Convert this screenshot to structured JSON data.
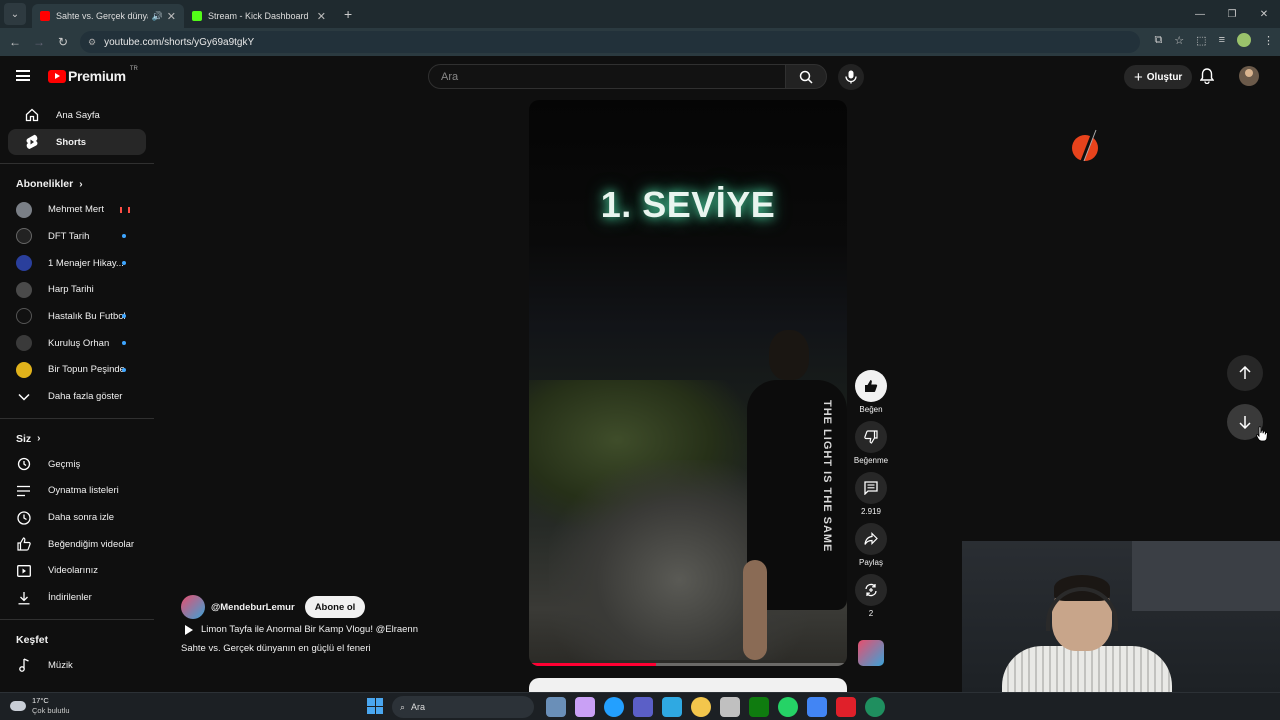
{
  "browser": {
    "tabs": [
      {
        "title": "Sahte vs. Gerçek dünyanın e",
        "active": true,
        "favicon_color": "#ff0000"
      },
      {
        "title": "Stream - Kick Dashboard",
        "active": false,
        "favicon_color": "#53fc18"
      }
    ],
    "url": "youtube.com/shorts/yGy69a9tgkY"
  },
  "header": {
    "logo_text": "Premium",
    "logo_region": "TR",
    "search_placeholder": "Ara",
    "create_label": "Oluştur"
  },
  "sidebar": {
    "main": [
      {
        "label": "Ana Sayfa",
        "icon": "home-icon"
      },
      {
        "label": "Shorts",
        "icon": "shorts-icon",
        "active": true
      }
    ],
    "subs_heading": "Abonelikler",
    "subs": [
      {
        "label": "Mehmet Mert",
        "avatar_color": "#7a7f86",
        "indicator": "live"
      },
      {
        "label": "DFT Tarih",
        "avatar_color": "#222222",
        "indicator": "dot"
      },
      {
        "label": "1 Menajer Hikay...",
        "avatar_color": "#2a3f9c",
        "indicator": "dot"
      },
      {
        "label": "Harp Tarihi",
        "avatar_color": "#4a4a4a",
        "indicator": "none"
      },
      {
        "label": "Hastalık Bu Futbol",
        "avatar_color": "#111111",
        "indicator": "dot"
      },
      {
        "label": "Kuruluş Orhan",
        "avatar_color": "#3a3a3a",
        "indicator": "dot"
      },
      {
        "label": "Bir Topun Peşinde",
        "avatar_color": "#e0b21b",
        "indicator": "dot"
      }
    ],
    "show_more": "Daha fazla göster",
    "you_heading": "Siz",
    "you": [
      {
        "label": "Geçmiş",
        "icon": "history-icon"
      },
      {
        "label": "Oynatma listeleri",
        "icon": "playlists-icon"
      },
      {
        "label": "Daha sonra izle",
        "icon": "watch-later-icon"
      },
      {
        "label": "Beğendiğim videolar",
        "icon": "liked-videos-icon"
      },
      {
        "label": "Videolarınız",
        "icon": "your-videos-icon"
      },
      {
        "label": "İndirilenler",
        "icon": "downloads-icon"
      }
    ],
    "explore_heading": "Keşfet",
    "explore": [
      {
        "label": "Müzik",
        "icon": "music-icon"
      }
    ]
  },
  "video": {
    "overlay_text": "1. SEVİYE",
    "shirt_text": "THE LIGHT IS THE SAME",
    "progress": 0.4,
    "channel": "@MendeburLemur",
    "subscribe_label": "Abone ol",
    "playlist": "Limon Tayfa ile Anormal Bir Kamp Vlogu! @Elraenn",
    "caption": "Sahte vs. Gerçek dünyanın en güçlü el feneri"
  },
  "actions": {
    "like": "Beğen",
    "dislike": "Beğenme",
    "comments": "2.919",
    "share": "Paylaş",
    "remix": "2"
  },
  "taskbar": {
    "temp": "17°C",
    "weather": "Çok bulutlu",
    "search": "Ara",
    "icon_colors": [
      "#6a8fb8",
      "#c9a0f5",
      "#23a0ff",
      "#5b5fc7",
      "#2fa9e2",
      "#f3c64c",
      "#c0c0c0",
      "#0f7b0f",
      "#25d366",
      "#4285f4",
      "#e0202a",
      "#1f8f5f"
    ]
  }
}
